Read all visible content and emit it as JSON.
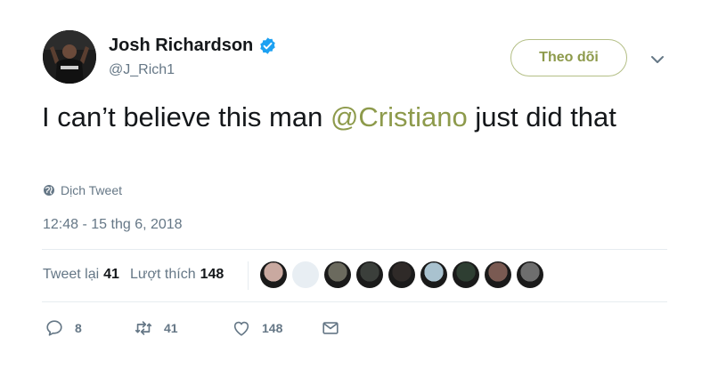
{
  "author": {
    "name": "Josh Richardson",
    "handle": "@J_Rich1",
    "verified": true
  },
  "follow_button": {
    "label": "Theo dõi"
  },
  "tweet": {
    "text_before": "I can’t believe this man ",
    "mention": "@Cristiano",
    "text_after": " just did that"
  },
  "translate": {
    "label": "Dịch Tweet"
  },
  "timestamp": "12:48 - 15 thg 6, 2018",
  "stats": {
    "retweets_label": "Tweet lại",
    "retweets_count": "41",
    "likes_label": "Lượt thích",
    "likes_count": "148"
  },
  "likers": [
    {
      "color": "#c9a9a0"
    },
    {
      "color": "#e8eef3"
    },
    {
      "color": "#6b6a5e"
    },
    {
      "color": "#3b3f3b"
    },
    {
      "color": "#2f2a28"
    },
    {
      "color": "#a9c2cf"
    },
    {
      "color": "#2e3e32"
    },
    {
      "color": "#7a5a52"
    },
    {
      "color": "#6e6e6e"
    }
  ],
  "actions": {
    "reply_count": "8",
    "retweet_count": "41",
    "like_count": "148"
  },
  "colors": {
    "accent": "#8d9a4b",
    "muted": "#657786",
    "text": "#14171a",
    "verified": "#1da1f2"
  }
}
